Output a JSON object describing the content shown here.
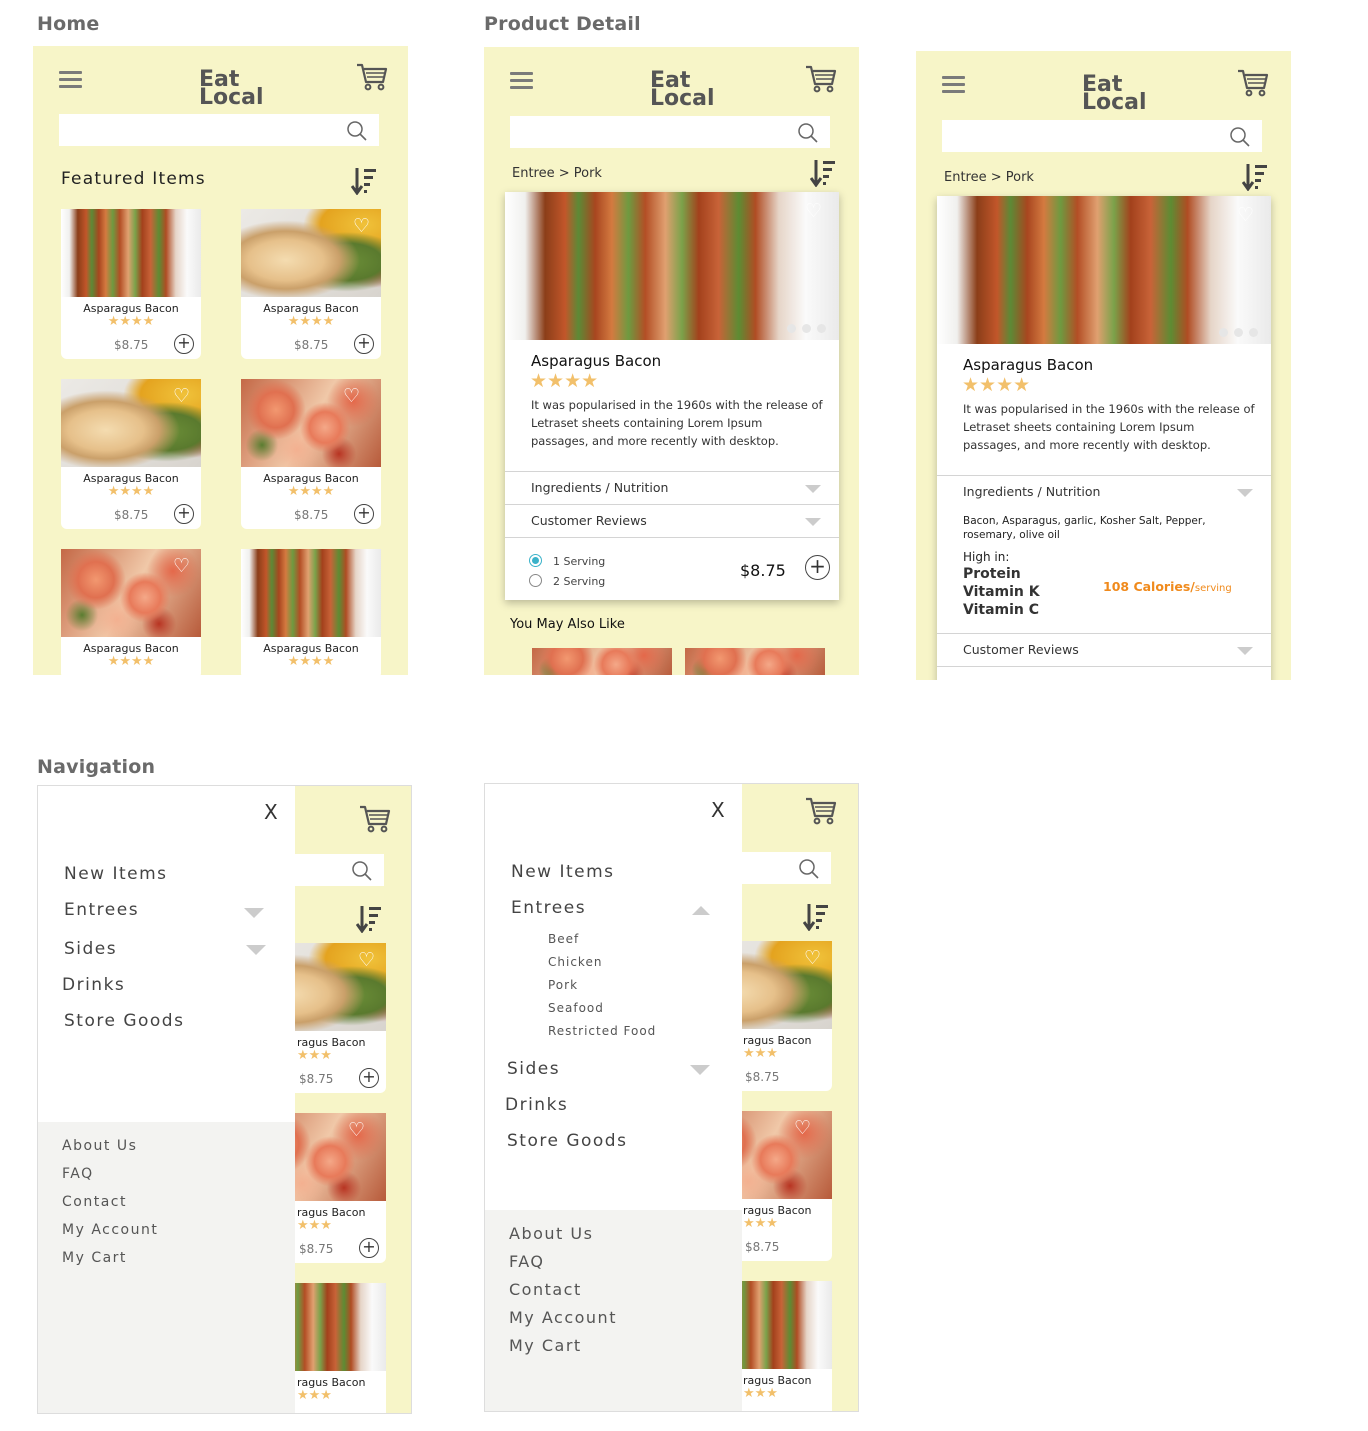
{
  "sections": {
    "home": "Home",
    "product_detail": "Product Detail",
    "navigation": "Navigation"
  },
  "logo": {
    "line1": "Eat",
    "line2": "Local"
  },
  "home": {
    "heading": "Featured Items",
    "items": [
      {
        "name": "Asparagus Bacon",
        "stars": "★★★★",
        "price": "$8.75",
        "image": "bacon-asparagus"
      },
      {
        "name": "Asparagus Bacon",
        "stars": "★★★★",
        "price": "$8.75",
        "image": "grilled-chicken"
      },
      {
        "name": "Asparagus Bacon",
        "stars": "★★★★",
        "price": "$8.75",
        "image": "grilled-chicken"
      },
      {
        "name": "Asparagus Bacon",
        "stars": "★★★★",
        "price": "$8.75",
        "image": "shrimp"
      },
      {
        "name": "Asparagus Bacon",
        "stars": "★★★★",
        "price": "",
        "image": "shrimp"
      },
      {
        "name": "Asparagus Bacon",
        "stars": "★★★★",
        "price": "",
        "image": "bacon-asparagus"
      }
    ]
  },
  "detail": {
    "breadcrumb": "Entree > Pork",
    "title": "Asparagus Bacon",
    "stars": "★★★★",
    "desc_lines": [
      "It was popularised in the 1960s with the release of",
      "Letraset sheets containing Lorem Ipsum",
      "passages, and more recently with desktop."
    ],
    "ingredients_label": "Ingredients / Nutrition",
    "reviews_label": "Customer Reviews",
    "serving1": "1 Serving",
    "serving2": "2 Serving",
    "price": "$8.75",
    "also_like": "You May Also Like",
    "ingredients_lines": [
      "Bacon, Asparagus, garlic, Kosher Salt, Pepper,",
      "rosemary, olive oil"
    ],
    "high_in": "High in:",
    "nutrients": [
      "Protein",
      "Vitamin K",
      "Vitamin C"
    ],
    "calories": "108 Calories/",
    "calories_unit": "serving",
    "colors": {
      "calories": "#f08a1c",
      "radio": "#3bb2c9",
      "stars": "#f2c06b",
      "background": "#f7f5c8"
    }
  },
  "nav": {
    "close": "X",
    "items": [
      "New Items",
      "Entrees",
      "Sides",
      "Drinks",
      "Store Goods"
    ],
    "entrees_sub": [
      "Beef",
      "Chicken",
      "Pork",
      "Seafood",
      "Restricted Food"
    ],
    "footer": [
      "About Us",
      "FAQ",
      "Contact",
      "My Account",
      "My Cart"
    ],
    "behind_items": [
      {
        "name": "ragus Bacon",
        "stars": "★★★",
        "price": "$8.75"
      },
      {
        "name": "ragus Bacon",
        "stars": "★★★",
        "price": "$8.75"
      },
      {
        "name": "ragus Bacon",
        "stars": "★★★",
        "price": ""
      }
    ]
  }
}
